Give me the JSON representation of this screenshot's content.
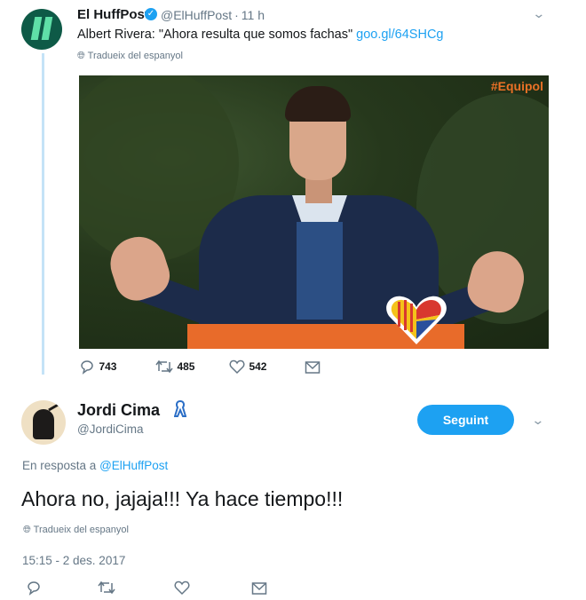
{
  "original_tweet": {
    "account_name": "El HuffPost",
    "verified_mark": "✓",
    "handle": "@ElHuffPost",
    "separator": "·",
    "time_ago": "11 h",
    "text_prefix": "Albert Rivera: \"Ahora resulta que somos fachas\" ",
    "link": "goo.gl/64SHCg",
    "translate": "Tradueix del espanyol",
    "image_tag": "#Equipol",
    "stats": {
      "replies": "743",
      "retweets": "485",
      "likes": "542"
    }
  },
  "reply_tweet": {
    "account_name": "Jordi Cima",
    "handle": "@JordiCima",
    "follow_label": "Seguint",
    "reply_prefix": "En resposta a ",
    "reply_mention": "@ElHuffPost",
    "text": "Ahora no, jajaja!!! Ya hace tiempo!!!",
    "translate": "Tradueix del espanyol",
    "timestamp": "15:15 - 2 des. 2017"
  },
  "icons": {
    "reply": "reply-icon",
    "retweet": "retweet-icon",
    "like": "heart-icon",
    "dm": "envelope-icon",
    "globe": "globe-icon",
    "chevron": "chevron-down-icon",
    "ribbon": "ribbon-icon"
  },
  "colors": {
    "accent": "#1da1f2",
    "muted": "#657786",
    "thread": "#c4e3f7",
    "text": "#14171a"
  }
}
